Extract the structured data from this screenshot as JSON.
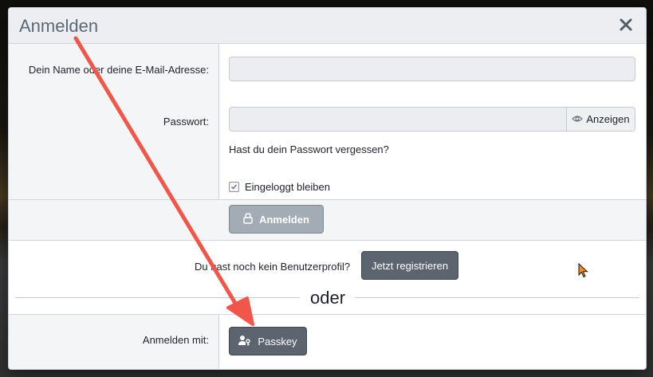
{
  "dialog": {
    "title": "Anmelden",
    "close_icon": "close-icon"
  },
  "form": {
    "username_label": "Dein Name oder deine E-Mail-Adresse:",
    "username_value": "",
    "password_label": "Passwort:",
    "password_value": "",
    "show_password_label": "Anzeigen",
    "show_password_icon": "eye-icon",
    "forgot_password": "Hast du dein Passwort vergessen?",
    "remember_label": "Eingeloggt bleiben",
    "remember_checked": true,
    "submit_label": "Anmelden",
    "submit_icon": "lock-icon"
  },
  "register": {
    "prompt": "Du hast noch kein Benutzerprofil?",
    "button_label": "Jetzt registrieren"
  },
  "separator": {
    "text": "oder"
  },
  "alt_login": {
    "label": "Anmelden mit:",
    "passkey_label": "Passkey",
    "passkey_icon": "user-key-icon"
  },
  "colors": {
    "accent_arrow": "#f0564a",
    "disabled_button": "#a3abb5",
    "dark_button": "#5c6470",
    "cursor": "#f28a1e"
  }
}
